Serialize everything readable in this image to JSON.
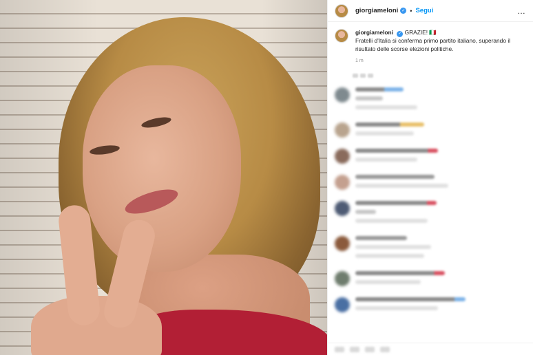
{
  "post": {
    "username": "giorgiameloni",
    "follow_label": "Segui",
    "separator": "•",
    "more_label": "…",
    "verified_mark": "✓",
    "caption_title": "GRAZIE! 🇮🇹",
    "caption_text": "Fratelli d'Italia si conferma primo partito italiano, superando il risultato delle scorse elezioni politiche.",
    "time": "1 m"
  },
  "colors": {
    "accent": "#0095f6",
    "verified": "#3897f0",
    "shirt": "#b21f35"
  },
  "icons": {
    "verified": "verified-badge-icon",
    "more": "more-options-icon"
  },
  "comments": {
    "note": ""
  }
}
